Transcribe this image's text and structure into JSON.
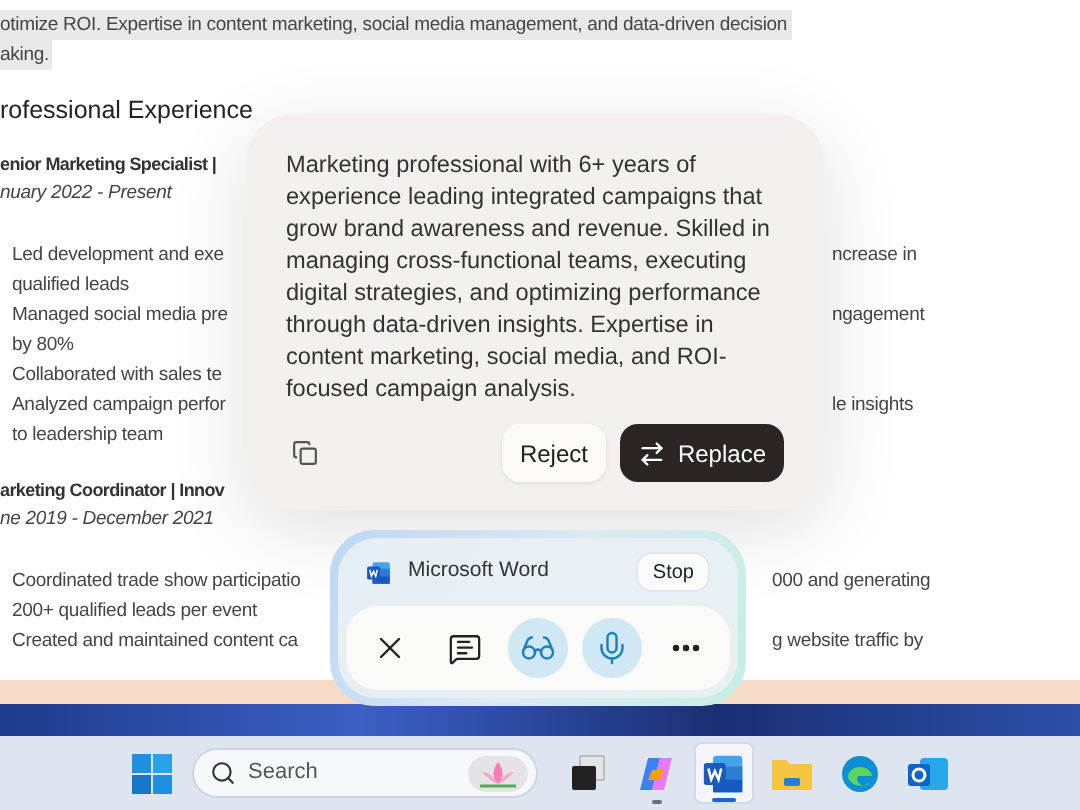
{
  "document": {
    "intro_lines": [
      {
        "text": "otimize ROI. Expertise in content marketing, social media management, and data-driven decision",
        "highlighted": true
      },
      {
        "text": "aking.",
        "highlighted": true
      }
    ],
    "heading": "rofessional Experience",
    "jobs": [
      {
        "title": "enior Marketing Specialist |",
        "dates": "nuary 2022 - Present",
        "lines": [
          {
            "left": "Led development and exe",
            "right": "ncrease in"
          },
          {
            "left": "qualified leads"
          },
          {
            "left": "Managed social media pre",
            "right": "ngagement"
          },
          {
            "left": "by 80%"
          },
          {
            "left": "Collaborated with sales te"
          },
          {
            "left": "Analyzed campaign perfor",
            "right": "le insights"
          },
          {
            "left": "to leadership team"
          }
        ]
      },
      {
        "title": "arketing Coordinator | Innov",
        "dates": "ne 2019 - December 2021",
        "lines": [
          {
            "left": "Coordinated trade show participatio",
            "right": "000 and generating"
          },
          {
            "left": "200+ qualified leads per event"
          },
          {
            "left": "Created and maintained content ca",
            "right": "g website traffic by"
          }
        ]
      }
    ]
  },
  "rewrite_popup": {
    "text": "Marketing professional with 6+ years of experience leading integrated campaigns that grow brand awareness and revenue. Skilled in managing cross-functional teams, executing digital strategies, and optimizing performance through data-driven insights. Expertise in content marketing, social media, and ROI-focused campaign analysis.",
    "buttons": [
      {
        "label": "Reject",
        "primary": false
      },
      {
        "label": "Replace",
        "primary": true
      }
    ]
  },
  "copilot_bar": {
    "app": "Microsoft Word",
    "stop": "Stop",
    "controls": [
      {
        "kind": "close",
        "active": false
      },
      {
        "kind": "chat",
        "active": false
      },
      {
        "kind": "vision",
        "active": true
      },
      {
        "kind": "voice",
        "active": true
      },
      {
        "kind": "more",
        "active": false
      }
    ]
  },
  "taskbar": {
    "search": {
      "placeholder": "Search"
    },
    "apps": [
      {
        "kind": "taskview",
        "selected": false,
        "running": false
      },
      {
        "kind": "copilot",
        "selected": false,
        "running": true
      },
      {
        "kind": "word",
        "selected": true,
        "running": true
      },
      {
        "kind": "explorer",
        "selected": false,
        "running": false
      },
      {
        "kind": "edge",
        "selected": false,
        "running": false
      },
      {
        "kind": "outlook",
        "selected": false,
        "running": false
      }
    ]
  }
}
